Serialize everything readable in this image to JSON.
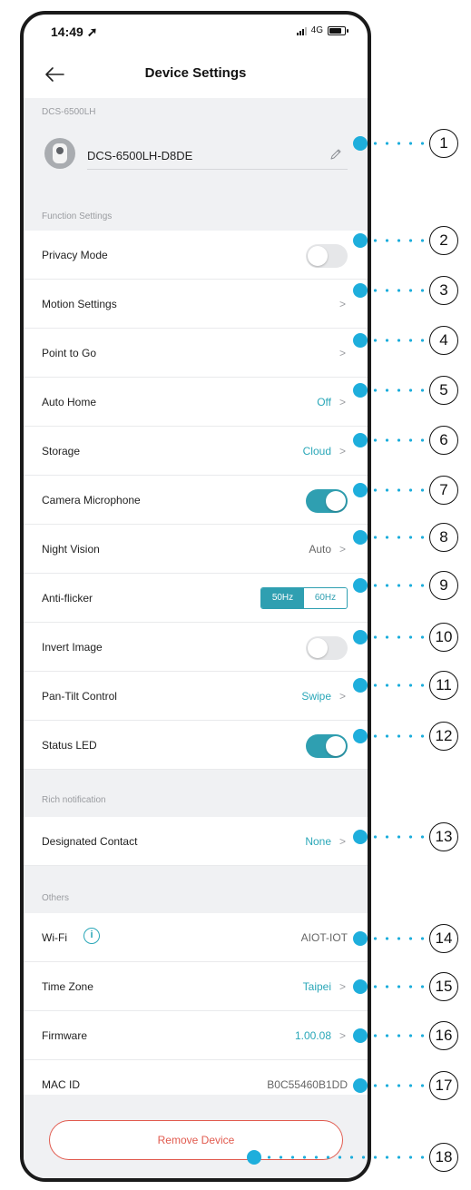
{
  "status_bar": {
    "time": "14:49",
    "network": "4G"
  },
  "nav": {
    "title": "Device Settings"
  },
  "device": {
    "model": "DCS-6500LH",
    "name": "DCS-6500LH-D8DE"
  },
  "sections": {
    "function": "Function Settings",
    "rich": "Rich notification",
    "others": "Others"
  },
  "rows": {
    "privacy_mode": {
      "label": "Privacy Mode",
      "enabled": false
    },
    "motion_settings": {
      "label": "Motion Settings"
    },
    "point_to_go": {
      "label": "Point to Go"
    },
    "auto_home": {
      "label": "Auto Home",
      "value": "Off"
    },
    "storage": {
      "label": "Storage",
      "value": "Cloud"
    },
    "camera_microphone": {
      "label": "Camera Microphone",
      "enabled": true
    },
    "night_vision": {
      "label": "Night Vision",
      "value": "Auto"
    },
    "anti_flicker": {
      "label": "Anti-flicker",
      "options": [
        "50Hz",
        "60Hz"
      ],
      "selected": "50Hz"
    },
    "invert_image": {
      "label": "Invert Image",
      "enabled": false
    },
    "pan_tilt": {
      "label": "Pan-Tilt Control",
      "value": "Swipe"
    },
    "status_led": {
      "label": "Status LED",
      "enabled": true
    },
    "designated_contact": {
      "label": "Designated Contact",
      "value": "None"
    },
    "wifi": {
      "label": "Wi-Fi",
      "value": "AIOT-IOT"
    },
    "time_zone": {
      "label": "Time Zone",
      "value": "Taipei"
    },
    "firmware": {
      "label": "Firmware",
      "value": "1.00.08"
    },
    "mac_id": {
      "label": "MAC ID",
      "value": "B0C55460B1DD"
    }
  },
  "remove_button": {
    "label": "Remove Device"
  },
  "callouts": [
    "1",
    "2",
    "3",
    "4",
    "5",
    "6",
    "7",
    "8",
    "9",
    "10",
    "11",
    "12",
    "13",
    "14",
    "15",
    "16",
    "17",
    "18"
  ],
  "colors": {
    "accent": "#2f9fb1",
    "callout": "#1eaedc",
    "danger": "#e15a4e",
    "section_bg": "#f0f1f3"
  }
}
